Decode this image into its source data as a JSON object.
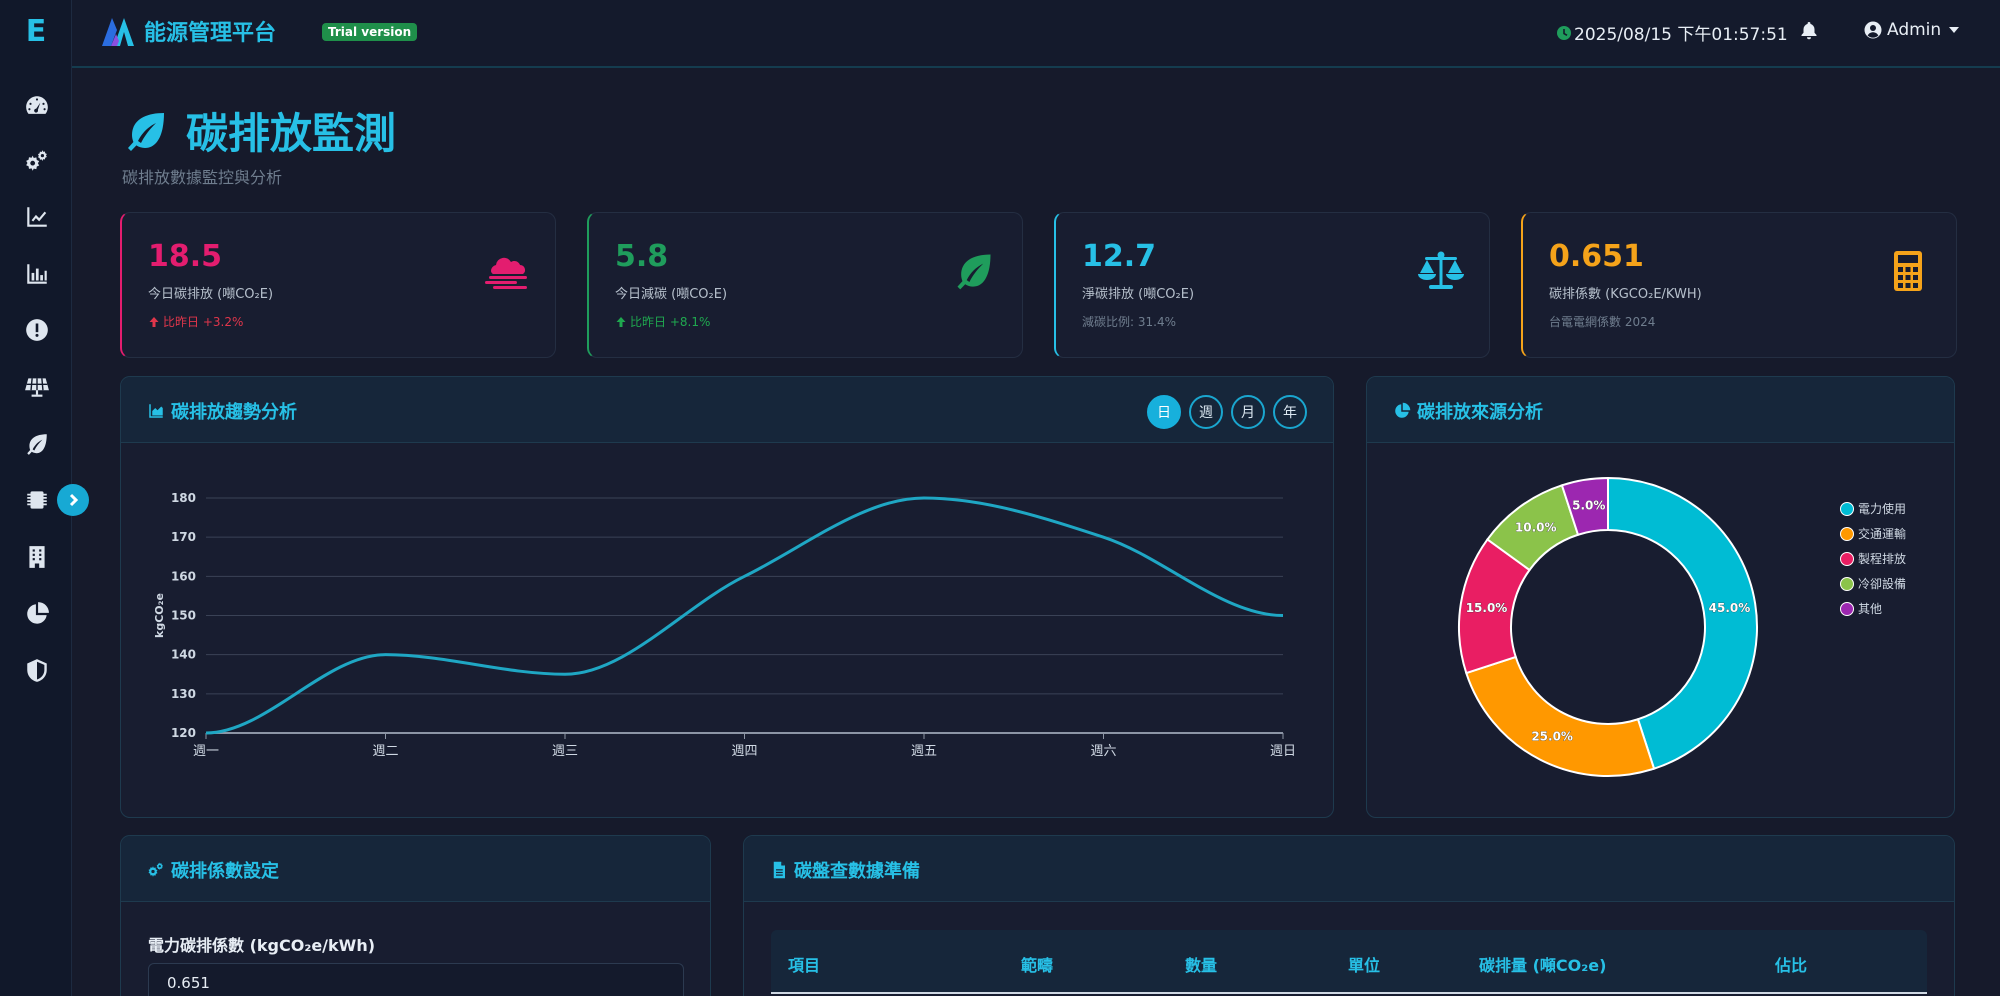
{
  "sidebar": {
    "logo": "E",
    "items": [
      "dashboard",
      "settings",
      "trend",
      "report",
      "alert",
      "solar",
      "leaf",
      "chip",
      "building",
      "pie",
      "shield"
    ]
  },
  "header": {
    "brand": "能源管理平台",
    "trial_badge": "Trial version",
    "datetime": "2025/08/15 下午01:57:51",
    "user": "Admin"
  },
  "page": {
    "title": "碳排放監測",
    "subtitle": "碳排放數據監控與分析"
  },
  "stats": [
    {
      "value": "18.5",
      "label": "今日碳排放 (噸CO₂E)",
      "note": "比昨日 +3.2%",
      "color": "#e31d6f"
    },
    {
      "value": "5.8",
      "label": "今日減碳 (噸CO₂E)",
      "note": "比昨日 +8.1%",
      "color": "#1f9d5c"
    },
    {
      "value": "12.7",
      "label": "淨碳排放 (噸CO₂E)",
      "note": "減碳比例: 31.4%",
      "color": "#27c0e6"
    },
    {
      "value": "0.651",
      "label": "碳排係數 (KGCO₂E/KWH)",
      "note": "台電電網係數 2024",
      "color": "#f5a31a"
    }
  ],
  "trend_panel": {
    "title": "碳排放趨勢分析",
    "periods": [
      "日",
      "週",
      "月",
      "年"
    ],
    "active_period": "日"
  },
  "source_panel": {
    "title": "碳排放來源分析"
  },
  "chart_data": [
    {
      "type": "line",
      "categories": [
        "週一",
        "週二",
        "週三",
        "週四",
        "週五",
        "週六",
        "週日"
      ],
      "series": [
        {
          "values": [
            120,
            140,
            135,
            160,
            180,
            170,
            150
          ],
          "color": "#1fa7c4"
        }
      ],
      "xlabel": "",
      "ylabel": "kgCO₂e",
      "ylim": [
        120,
        180
      ],
      "yticks": [
        120,
        130,
        140,
        150,
        160,
        170,
        180
      ],
      "grid": true
    },
    {
      "type": "pie",
      "labels": [
        "電力使用",
        "交通運輸",
        "製程排放",
        "冷卻設備",
        "其他"
      ],
      "values": [
        45.0,
        25.0,
        15.0,
        10.0,
        5.0
      ],
      "value_labels": [
        "45.0%",
        "25.0%",
        "15.0%",
        "10.0%",
        "5.0%"
      ],
      "colors": [
        "#00bcd4",
        "#ff9800",
        "#e91e63",
        "#8bc34a",
        "#9c27b0"
      ],
      "legend": "right"
    }
  ],
  "coef_panel": {
    "title": "碳排係數設定",
    "field_label": "電力碳排係數 (kgCO₂e/kWh)",
    "field_value": "0.651"
  },
  "inventory_panel": {
    "title": "碳盤查數據準備",
    "columns": [
      "項目",
      "範疇",
      "數量",
      "單位",
      "碳排量 (噸CO₂e)",
      "佔比"
    ]
  }
}
